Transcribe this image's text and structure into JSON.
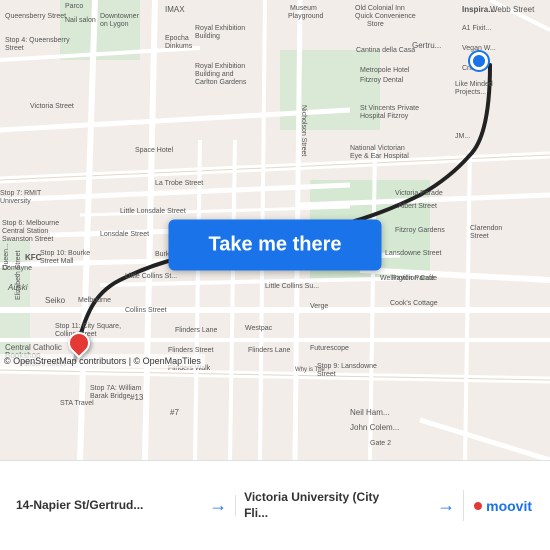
{
  "map": {
    "background_color": "#e8e0d8",
    "destination_label": "destination marker",
    "origin_label": "origin marker"
  },
  "button": {
    "label": "Take me there"
  },
  "attribution": {
    "text": "© OpenStreetMap contributors | © OpenMapTiles"
  },
  "bottom_bar": {
    "origin": {
      "label": "14-Napier St/Gertrud...",
      "arrow": "→"
    },
    "destination": {
      "label": "Victoria University (City Fli...",
      "arrow": "→"
    },
    "brand": {
      "name": "moovit"
    }
  }
}
